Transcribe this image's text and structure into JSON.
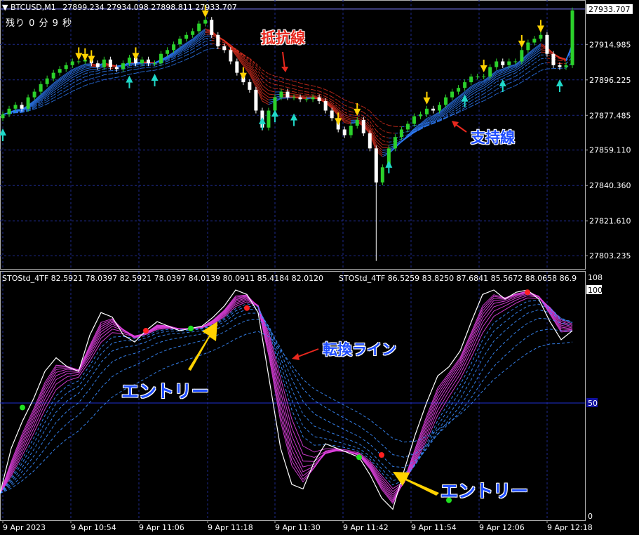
{
  "header": {
    "symbol": "BTCUSD,M1",
    "ohlc": "27899.234 27934.098 27898.811 27933.707",
    "countdown": "残り 0 分 9 秒",
    "indicator_1": "STOStd_4TF 82.5921 78.0397 82.5921 78.0397 84.0139 80.0911 85.4184 82.0120",
    "indicator_2": "STOStd_4TF 86.5259 83.8250 87.6841 85.5672 88.0658 86.9"
  },
  "annotations": {
    "resistance": "抵抗線",
    "support": "支持線",
    "turn_line": "転換ライン",
    "entry_1": "エントリー",
    "entry_2": "エントリー"
  },
  "colors": {
    "background": "#000000",
    "grid": "#1e2a8c",
    "bull_candle": "#2bd12b",
    "bear_candle": "#ffffff",
    "resistance_band": "#e03020",
    "support_band": "#2f7fff",
    "sto_band": "#e040e0",
    "sto_signal": "#3a8cff",
    "arrow_yellow": "#ffd200",
    "arrow_cyan": "#20d8c8",
    "annotation_red": "#e8281e",
    "annotation_blue": "#1e4cff"
  },
  "chart_data": [
    {
      "type": "candlestick",
      "title": "BTCUSD,M1",
      "price_axis_ticks": [
        "27933.707",
        "27914.985",
        "27896.225",
        "27877.485",
        "27859.110",
        "27840.360",
        "27821.610",
        "27803.235"
      ],
      "current_price": "27933.707",
      "ylim": [
        27797,
        27937
      ],
      "series": [
        {
          "name": "close",
          "values": [
            27878,
            27881,
            27883,
            27881,
            27887,
            27890,
            27894,
            27897,
            27900,
            27902,
            27904,
            27906,
            27906,
            27907,
            27905,
            27903,
            27907,
            27903,
            27902,
            27905,
            27908,
            27905,
            27907,
            27905,
            27905,
            27910,
            27912,
            27915,
            27918,
            27920,
            27922,
            27926,
            27928,
            27920,
            27914,
            27912,
            27906,
            27900,
            27895,
            27891,
            27880,
            27871,
            27880,
            27887,
            27890,
            27887,
            27887,
            27886,
            27886,
            27887,
            27885,
            27880,
            27876,
            27870,
            27867,
            27872,
            27875,
            27868,
            27860,
            27842,
            27850,
            27860,
            27866,
            27870,
            27873,
            27877,
            27878,
            27881,
            27880,
            27883,
            27887,
            27890,
            27892,
            27895,
            27898,
            27898,
            27898,
            27903,
            27906,
            27904,
            27906,
            27906,
            27912,
            27916,
            27918,
            27920,
            27910,
            27904,
            27903,
            27904,
            27933
          ]
        }
      ]
    },
    {
      "type": "line",
      "title": "STOStd_4TF",
      "y_axis_ticks": [
        "108",
        "100",
        "50",
        "0"
      ],
      "ylim": [
        0,
        100
      ],
      "series": [
        {
          "name": "STOStd_4TF",
          "values": [
            10,
            30,
            42,
            52,
            64,
            70,
            66,
            64,
            80,
            90,
            88,
            80,
            77,
            82,
            86,
            84,
            82,
            83,
            84,
            88,
            93,
            100,
            98,
            90,
            60,
            30,
            14,
            12,
            24,
            32,
            30,
            28,
            26,
            18,
            8,
            3,
            20,
            36,
            50,
            62,
            66,
            73,
            86,
            98,
            100,
            96,
            99,
            100,
            96,
            86,
            78,
            82
          ]
        }
      ]
    }
  ],
  "time_axis_ticks": [
    "9 Apr 2023",
    "9 Apr 10:54",
    "9 Apr 11:06",
    "9 Apr 11:18",
    "9 Apr 11:30",
    "9 Apr 11:42",
    "9 Apr 11:54",
    "9 Apr 12:06",
    "9 Apr 12:18"
  ]
}
